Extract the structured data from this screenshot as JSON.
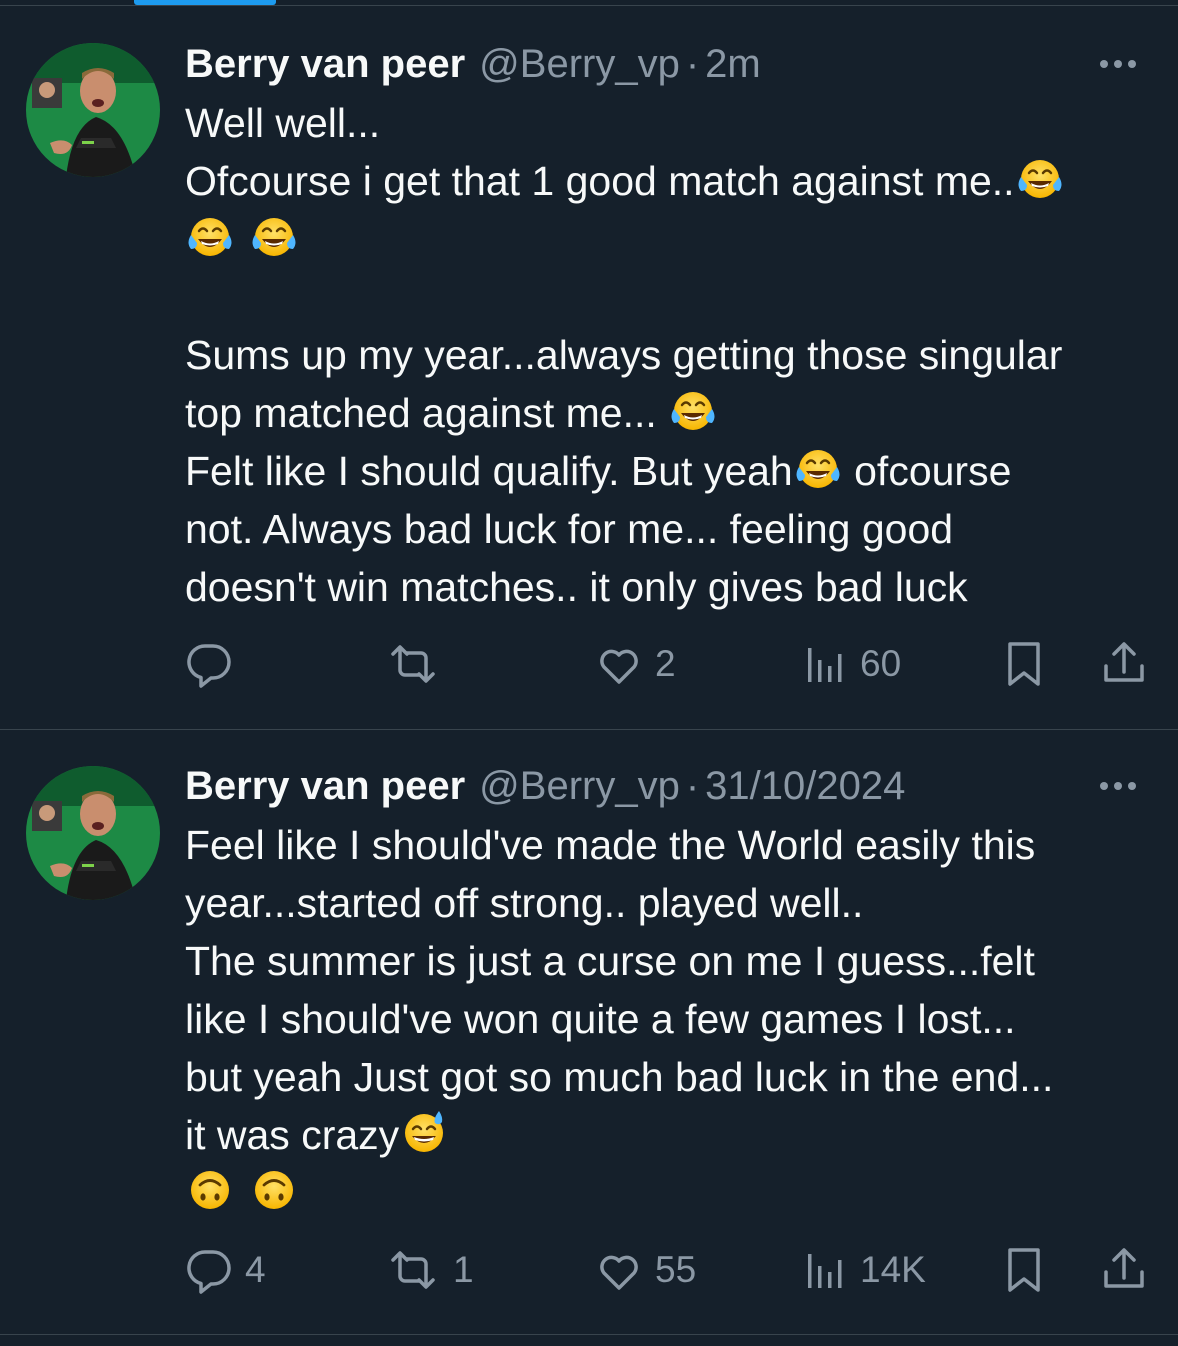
{
  "colors": {
    "background": "#15202b",
    "text_primary": "#f7f9f9",
    "text_secondary": "#8b98a5",
    "divider": "#38444d",
    "accent": "#1d9bf0"
  },
  "tweets": [
    {
      "display_name": "Berry van peer",
      "handle": "@Berry_vp",
      "separator": "·",
      "time": "2m",
      "lines": [
        {
          "text": "Well well..."
        },
        {
          "text": "Ofcourse i get that 1 good match against me..",
          "emoji_after": "face-with-tears-of-joy"
        },
        {
          "emoji_only": [
            "face-with-tears-of-joy",
            "face-with-tears-of-joy"
          ]
        },
        {
          "blank": true
        },
        {
          "text": "Sums up my year...always getting those singular"
        },
        {
          "text": "top matched against me... ",
          "emoji_after": "face-with-tears-of-joy"
        },
        {
          "text": "Felt like I should qualify. But yeah",
          "emoji_mid": "face-with-tears-of-joy",
          "text_after": " ofcourse"
        },
        {
          "text": "not. Always bad luck for me... feeling good"
        },
        {
          "text": "doesn't win matches.. it only gives bad luck"
        }
      ],
      "actions": {
        "reply_count": "",
        "retweet_count": "",
        "like_count": "2",
        "view_count": "60"
      }
    },
    {
      "display_name": "Berry van peer",
      "handle": "@Berry_vp",
      "separator": "·",
      "time": "31/10/2024",
      "lines": [
        {
          "text": "Feel like I should've made the World easily this"
        },
        {
          "text": "year...started off strong.. played well.."
        },
        {
          "text": "The summer is just a curse on me I guess...felt"
        },
        {
          "text": "like I should've won quite a few games I lost..."
        },
        {
          "text": "but yeah Just got so much bad luck in the end..."
        },
        {
          "text": "it was crazy",
          "emoji_after": "grinning-face-with-sweat"
        },
        {
          "emoji_only": [
            "upside-down-face",
            "upside-down-face"
          ]
        }
      ],
      "actions": {
        "reply_count": "4",
        "retweet_count": "1",
        "like_count": "55",
        "view_count": "14K"
      }
    }
  ]
}
